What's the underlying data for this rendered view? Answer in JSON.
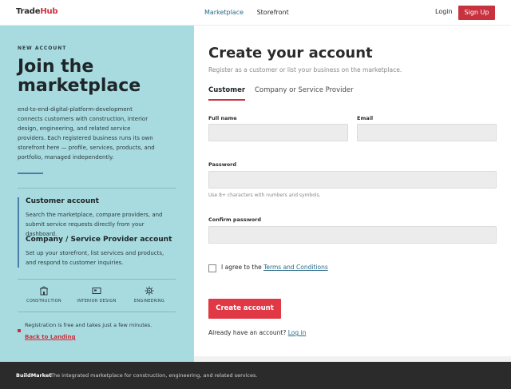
{
  "header": {
    "logo_main": "Trade",
    "logo_accent": "Hub",
    "nav": [
      "Marketplace",
      "Storefront"
    ],
    "login": "Login",
    "signup": "Sign Up"
  },
  "left": {
    "eyebrow": "NEW ACCOUNT",
    "title": "Join the marketplace",
    "description": "end-to-end-digital-platform-development connects customers with construction, interior design, engineering, and related service providers. Each registered business runs its own storefront here — profile, services, products, and portfolio, managed independently.",
    "accounts": [
      {
        "title": "Customer account",
        "desc": "Search the marketplace, compare providers, and submit service requests directly from your dashboard."
      },
      {
        "title": "Company / Service Provider account",
        "desc": "Set up your storefront, list services and products, and respond to customer inquiries."
      }
    ],
    "categories": [
      "CONSTRUCTION",
      "INTERIOR DESIGN",
      "ENGINEERING"
    ],
    "note": "Registration is free and takes just a few minutes.",
    "back": "Back to Landing"
  },
  "form": {
    "title": "Create your account",
    "subtitle": "Register as a customer or list your business on the marketplace.",
    "tabs": [
      "Customer",
      "Company or Service Provider"
    ],
    "full_name_label": "Full name",
    "email_label": "Email",
    "password_label": "Password",
    "password_hint": "Use 8+ characters with numbers and symbols.",
    "confirm_label": "Confirm password",
    "agree_prefix": "I agree to the ",
    "agree_link": "Terms and Conditions",
    "submit": "Create account",
    "already_prefix": "Already have an account? ",
    "already_link": "Log in"
  },
  "footer": {
    "brand": "BuildMarket",
    "text": "The integrated marketplace for construction, engineering, and related services."
  },
  "colors": {
    "accent": "#c8323f",
    "panel": "#a8dbdf",
    "link": "#2a6a8a"
  }
}
